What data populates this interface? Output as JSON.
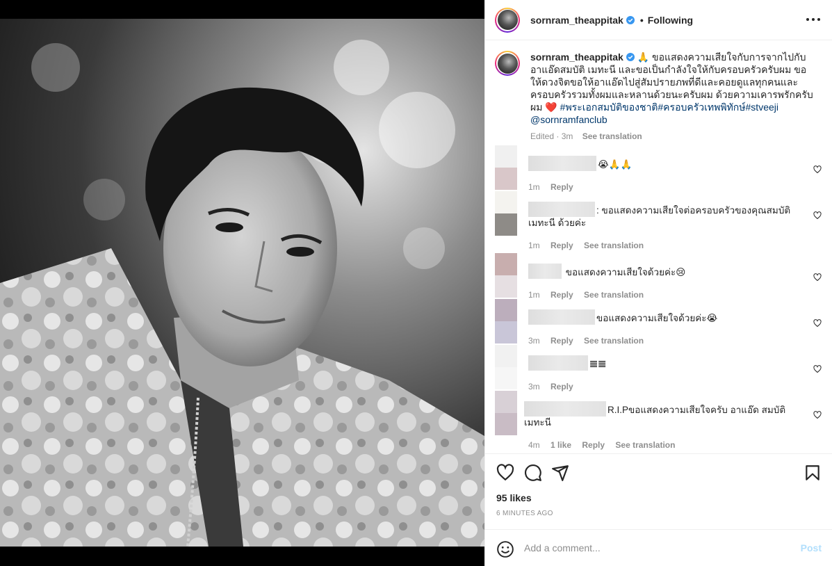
{
  "header": {
    "username": "sornram_theappitak",
    "separator": "•",
    "follow_status": "Following"
  },
  "caption": {
    "username": "sornram_theappitak",
    "emoji": "🙏",
    "text": " ขอแสดงความเสียใจกับการจากไปกับอาแอ๊ดสมบัติ เมทะนี และขอเป็นกำลังใจให้กับครอบครัวครับผม ขอให้ดวงจิตขอให้อาแอ๊ดไปสู่สัมปรายภพที่ดีและคอยดูแลทุกคนและครอบครัวรวมทั้งผมและหลานด้วยนะครับผม ด้วยความเคารพรักครับผม ",
    "heart": "❤️",
    "hashtags": " #พระเอกสมบัติของชาติ#ครอบครัวเทพพิทักษ์#stveeji",
    "mention": "@sornramfanclub",
    "meta_time": "Edited · 3m",
    "see_translation": "See translation"
  },
  "comments": [
    {
      "text": "😭🙏🙏",
      "time": "1m",
      "likes": "",
      "reply": "Reply",
      "translate": ""
    },
    {
      "text": ": ขอแสดงความเสียใจต่อครอบครัวของคุณสมบัติ เมทะนี ด้วยค่ะ",
      "time": "1m",
      "likes": "",
      "reply": "Reply",
      "translate": "See translation"
    },
    {
      "text": " ขอแสดงความเสียใจด้วยค่ะ😢",
      "time": "1m",
      "likes": "",
      "reply": "Reply",
      "translate": "See translation"
    },
    {
      "text": "ขอแสดงความเสียใจด้วยค่ะ😭",
      "time": "3m",
      "likes": "",
      "reply": "Reply",
      "translate": "See translation"
    },
    {
      "text": "𝌆𝌆",
      "time": "3m",
      "likes": "",
      "reply": "Reply",
      "translate": ""
    },
    {
      "text": "R.I.Pขอแสดงความเสียใจครับ อาแอ๊ด สมบัติ เมทะนี",
      "time": "4m",
      "likes": "1 like",
      "reply": "Reply",
      "translate": "See translation"
    }
  ],
  "engagement": {
    "likes": "95 likes",
    "time_ago": "6 MINUTES AGO"
  },
  "add_comment": {
    "placeholder": "Add a comment...",
    "post_label": "Post"
  },
  "colors": {
    "verified": "#3897f0",
    "link": "#00376b",
    "post_disabled": "#b2dffc",
    "muted": "#8e8e8e"
  },
  "icons": [
    "verified-badge-icon",
    "more-options-icon",
    "heart-icon",
    "comment-icon",
    "share-icon",
    "bookmark-icon",
    "emoji-icon"
  ]
}
